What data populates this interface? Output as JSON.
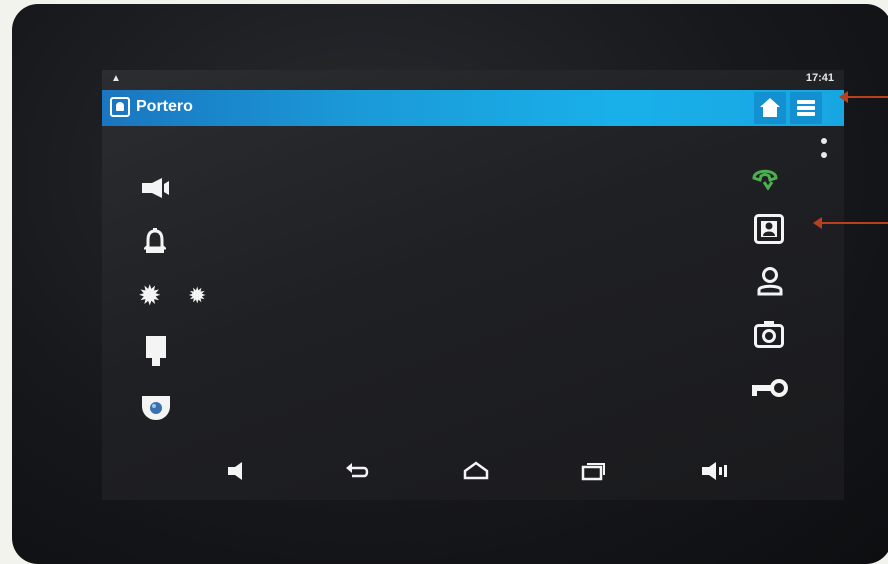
{
  "statusbar": {
    "time": "17:41",
    "notification_icon": "triangle-notification-icon"
  },
  "appbar": {
    "title": "Portero",
    "app_icon": "intercom-icon",
    "home_button_icon": "home-icon",
    "menu_button_icon": "menu-icon",
    "overflow_icon": "overflow-dots-icon"
  },
  "left_controls": [
    {
      "name": "speaker-icon"
    },
    {
      "name": "bell-icon"
    },
    {
      "name": "light-icon"
    },
    {
      "name": "light-small-icon"
    },
    {
      "name": "door-icon"
    },
    {
      "name": "camera-dome-icon"
    }
  ],
  "right_controls": [
    {
      "name": "hang-up-icon",
      "color": "#4caf50"
    },
    {
      "name": "contact-card-icon"
    },
    {
      "name": "user-icon"
    },
    {
      "name": "snapshot-camera-icon"
    },
    {
      "name": "key-icon"
    }
  ],
  "navbar": [
    "volume-down-icon",
    "back-icon",
    "home-nav-icon",
    "recent-apps-icon",
    "volume-up-icon"
  ],
  "colors": {
    "appbar_start": "#1a76c0",
    "appbar_end": "#18a6e2",
    "hangup_green": "#4caf50",
    "annotation_arrow": "#b8401f"
  }
}
